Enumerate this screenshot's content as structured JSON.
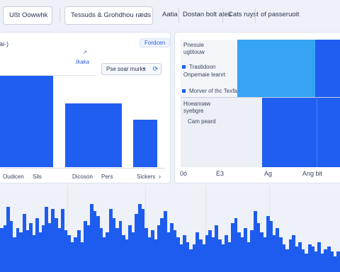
{
  "toolbar": {
    "field_1": "Ußt Oowwhk",
    "field_2": "Tessuds & Grohdhou ræds",
    "label_1": "Aatia",
    "label_2": "Dostan bolt ates",
    "label_3": "Cats ruyst",
    "label_4": "of passeruoit"
  },
  "left_panel": {
    "partial_title": "ai-)",
    "badge": "Fordcen",
    "link": "Ikaka",
    "select_value": "Pse soar murks",
    "x_labels": [
      "Oudicen",
      "Sils",
      "Dicoson",
      "Pers",
      "Sickers"
    ],
    "chevron": "›"
  },
  "right_panel": {
    "text_1": "Pnesuie",
    "text_2": "ugtitouw",
    "legend": [
      "Trastidoon",
      "Onpemaie leanrt",
      "Morver of thc Texfa"
    ],
    "text_3": "Hoeanoaw",
    "text_4": "syebgre",
    "text_5": "Cam peard",
    "axis": [
      "0ό",
      "E3",
      "Ag",
      "Ang bit"
    ]
  },
  "colors": {
    "accent": "#1f5ef0",
    "light_accent": "#36a3f3"
  },
  "chart_data": [
    {
      "type": "bar",
      "categories": [
        "Oudicen",
        "Sils",
        "Dicoson",
        "Pers",
        "Sickers"
      ],
      "values": [
        129,
        129,
        90,
        90,
        67
      ]
    },
    {
      "type": "bar",
      "values": [
        62,
        66,
        92,
        72,
        49,
        62,
        56,
        82,
        59,
        69,
        52,
        76,
        56,
        66,
        92,
        69,
        89,
        76,
        62,
        89,
        59,
        52,
        42,
        49,
        59,
        42,
        72,
        66,
        96,
        86,
        79,
        62,
        49,
        56,
        89,
        76,
        62,
        72,
        52,
        46,
        66,
        56,
        82,
        96,
        89,
        62,
        49,
        59,
        46,
        66,
        76,
        86,
        56,
        69,
        59,
        49,
        39,
        52,
        42,
        32,
        39,
        56,
        46,
        39,
        52,
        59,
        49,
        66,
        46,
        39,
        52,
        42,
        69,
        76,
        56,
        49,
        62,
        42,
        59,
        86,
        69,
        56,
        49,
        79,
        72,
        52,
        62,
        49,
        39,
        32,
        46,
        52,
        36,
        42,
        32,
        26,
        39,
        36,
        29,
        42,
        26,
        32,
        36,
        29,
        22,
        29
      ]
    }
  ]
}
